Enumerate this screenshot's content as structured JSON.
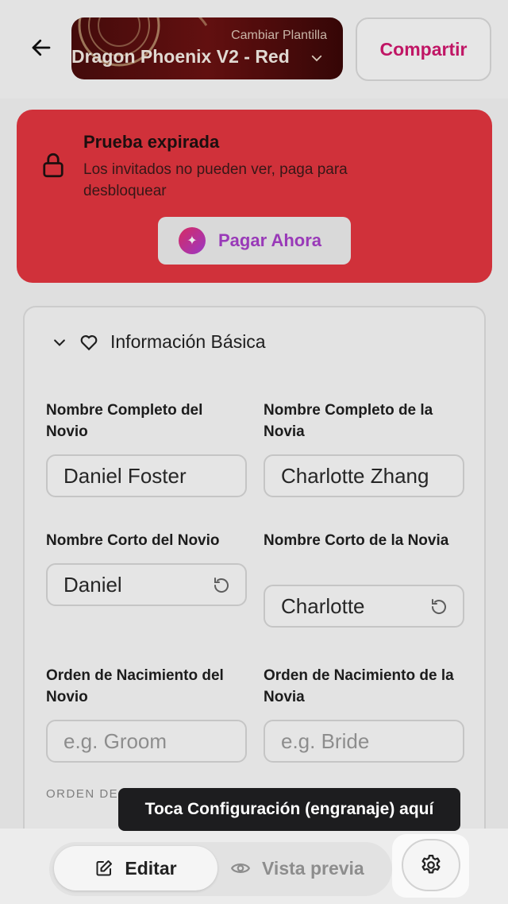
{
  "header": {
    "template_subtitle": "Cambiar Plantilla",
    "template_title": "Dragon Phoenix V2 - Red",
    "share_label": "Compartir"
  },
  "alert": {
    "title": "Prueba expirada",
    "text": "Los invitados no pueden ver, paga para desbloquear",
    "pay_label": "Pagar Ahora"
  },
  "section": {
    "title": "Información Básica"
  },
  "fields": {
    "groom_full_label": "Nombre Completo del Novio",
    "groom_full_value": "Daniel Foster",
    "bride_full_label": "Nombre Completo de la Novia",
    "bride_full_value": "Charlotte Zhang",
    "groom_short_label": "Nombre Corto del Novio",
    "groom_short_value": "Daniel",
    "bride_short_label": "Nombre Corto de la Novia",
    "bride_short_value": "Charlotte",
    "groom_order_label": "Orden de Nacimiento del Novio",
    "groom_order_placeholder": "e.g. Groom",
    "bride_order_label": "Orden de Nacimiento de la Novia",
    "bride_order_placeholder": "e.g. Bride",
    "order_caption": "ORDEN DE"
  },
  "tooltip": {
    "text": "Toca Configuración (engranaje) aquí"
  },
  "bottom": {
    "edit_label": "Editar",
    "preview_label": "Vista previa"
  },
  "colors": {
    "alert_bg": "#e2363f",
    "share_text": "#d1186e",
    "pay_text": "#a63fc8"
  }
}
